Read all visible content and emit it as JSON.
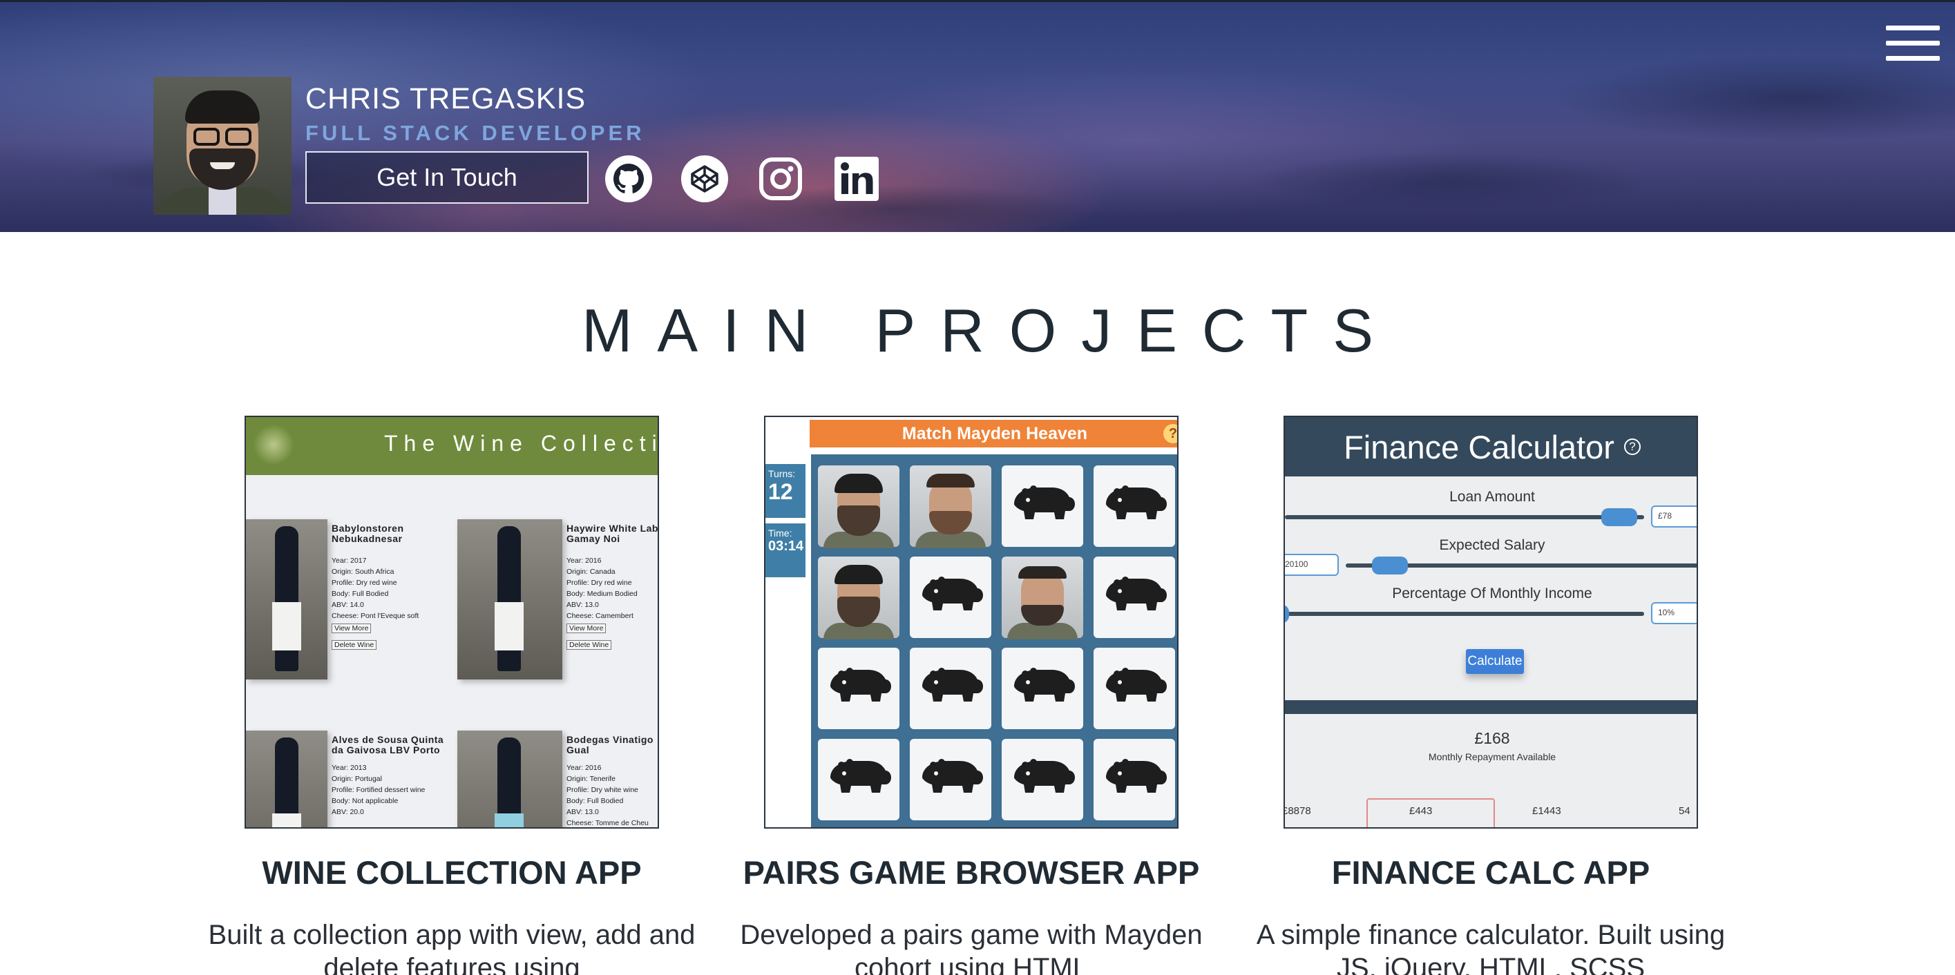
{
  "header": {
    "name": "CHRIS TREGASKIS",
    "role": "FULL STACK DEVELOPER",
    "contact_label": "Get In Touch",
    "menu_icon": "hamburger-icon",
    "social": [
      {
        "name": "github",
        "icon": "github-icon"
      },
      {
        "name": "codepen",
        "icon": "codepen-icon"
      },
      {
        "name": "instagram",
        "icon": "instagram-icon"
      },
      {
        "name": "linkedin",
        "icon": "linkedin-icon"
      }
    ]
  },
  "section": {
    "title": "MAIN PROJECTS"
  },
  "projects": [
    {
      "title": "WINE COLLECTION APP",
      "description": "Built a collection app with view, add and delete features using",
      "screenshot": {
        "banner": "The Wine Collecti",
        "wines": [
          {
            "name": "Babylonstoren Nebukadnesar",
            "year": "Year: 2017",
            "origin": "Origin: South Africa",
            "profile": "Profile: Dry red wine",
            "body": "Body: Full Bodied",
            "abv": "ABV: 14.0",
            "cheese": "Cheese: Pont l'Eveque soft",
            "view": "View More",
            "delete": "Delete Wine"
          },
          {
            "name": "Haywire White Label Gamay Noi",
            "year": "Year: 2016",
            "origin": "Origin: Canada",
            "profile": "Profile: Dry red wine",
            "body": "Body: Medium Bodied",
            "abv": "ABV: 13.0",
            "cheese": "Cheese: Camembert",
            "view": "View More",
            "delete": "Delete Wine"
          },
          {
            "name": "Alves de Sousa Quinta da Gaivosa LBV Porto",
            "year": "Year: 2013",
            "origin": "Origin: Portugal",
            "profile": "Profile: Fortified dessert wine",
            "body": "Body: Not applicable",
            "abv": "ABV: 20.0",
            "cheese": "",
            "view": "",
            "delete": ""
          },
          {
            "name": "Bodegas Vinatigo Gual",
            "year": "Year: 2016",
            "origin": "Origin: Tenerife",
            "profile": "Profile: Dry white wine",
            "body": "Body: Full Bodied",
            "abv": "ABV: 13.0",
            "cheese": "Cheese: Tomme de Cheu",
            "view": "",
            "delete": ""
          }
        ]
      }
    },
    {
      "title": "PAIRS GAME BROWSER APP",
      "description": "Developed a pairs game with Mayden cohort using HTML",
      "screenshot": {
        "header": "Match Mayden Heaven",
        "help": "?",
        "turns_label": "Turns:",
        "turns_value": "12",
        "time_label": "Time:",
        "time_value": "03:14"
      }
    },
    {
      "title": "FINANCE CALC APP",
      "description": "A simple finance calculator. Built using JS, jQuery, HTML, SCSS",
      "screenshot": {
        "title": "Finance Calculator",
        "help": "?",
        "loan_label": "Loan Amount",
        "loan_box": "£78",
        "salary_label": "Expected Salary",
        "salary_box": "20100",
        "percent_label": "Percentage Of Monthly Income",
        "percent_box": "10%",
        "calculate": "Calculate",
        "repayment": "£168",
        "repayment_label": "Monthly Repayment Available",
        "stats": [
          "£8878",
          "£443",
          "£1443",
          "54"
        ]
      }
    }
  ]
}
